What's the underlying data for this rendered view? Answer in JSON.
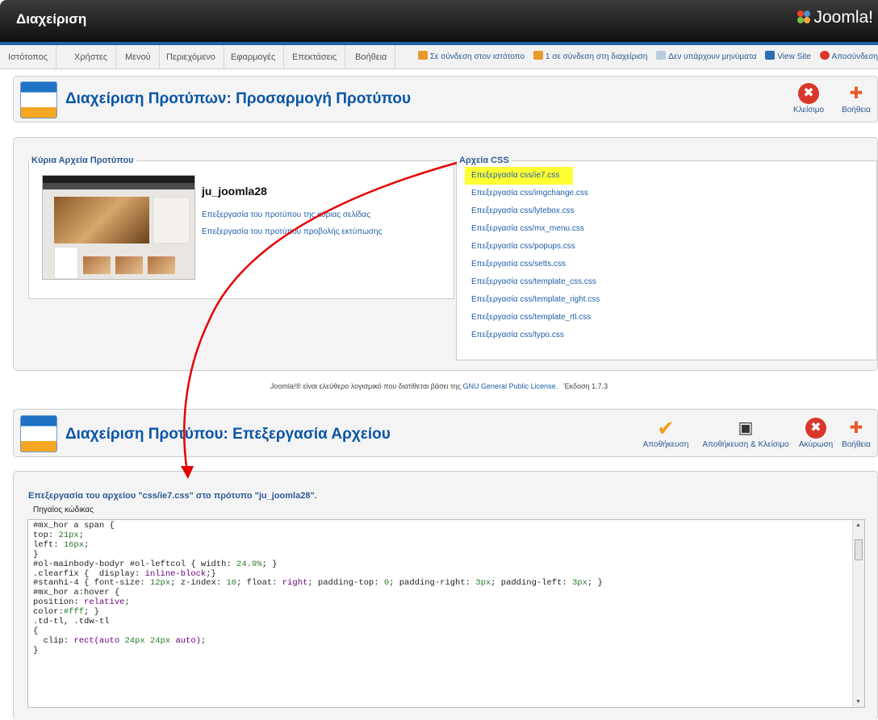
{
  "header": {
    "title": "Διαχείριση",
    "logo": "Joomla!"
  },
  "menu": {
    "items": [
      "Ιστότοπος",
      "Χρήστες",
      "Μενού",
      "Περιεχόμενο",
      "Εφαρμογές",
      "Επεκτάσεις",
      "Βοήθεια"
    ]
  },
  "status": {
    "online_site": "Σε σύνδεση στον ιστότοπο",
    "online_admin": "1 σε σύνδεση στη διαχείριση",
    "messages": "Δεν υπάρχουν μηνύματα",
    "view_site": "View Site",
    "logout": "Αποσύνδεση"
  },
  "panel1": {
    "title": "Διαχείριση Προτύπων: Προσαρμογή Προτύπου",
    "close": "Κλείσιμο",
    "help": "Βοήθεια"
  },
  "main_files": {
    "legend": "Κύρια Αρχεία Προτύπου",
    "template_name": "ju_joomla28",
    "links": [
      "Επεξεργασία του προτύπου της κύριας σελίδας",
      "Επεξεργασία του προτύπου προβολής εκτύπωσης"
    ]
  },
  "css_files": {
    "legend": "Αρχεία CSS",
    "links": [
      "Επεξεργασία css/ie7.css",
      "Επεξεργασία css/imgchange.css",
      "Επεξεργασία css/lytebox.css",
      "Επεξεργασία css/mx_menu.css",
      "Επεξεργασία css/popups.css",
      "Επεξεργασία css/setts.css",
      "Επεξεργασία css/template_css.css",
      "Επεξεργασία css/template_right.css",
      "Επεξεργασία css/template_rtl.css",
      "Επεξεργασία css/typo.css"
    ]
  },
  "footer": {
    "pre": "Joomla!® είναι ελεύθερο λογισμικό που διατίθεται βάσει της ",
    "link": "GNU General Public License.",
    "version": "Έκδοση 1.7.3"
  },
  "panel2": {
    "title": "Διαχείριση Προτύπου: Επεξεργασία Αρχείου",
    "save": "Αποθήκευση",
    "save_close": "Αποθήκευση & Κλείσιμο",
    "cancel": "Ακύρωση",
    "help": "Βοήθεια"
  },
  "editor": {
    "legend": "Επεξεργασία του αρχείου \"css/ie7.css\" στο πρότυπο \"ju_joomla28\".",
    "source_label": "Πηγαίος κώδικας"
  },
  "colors": {
    "header_bg": "#1a1a1a",
    "accent_blue": "#1f63a3",
    "highlight": "#ffff33",
    "arrow": "#e60000"
  }
}
